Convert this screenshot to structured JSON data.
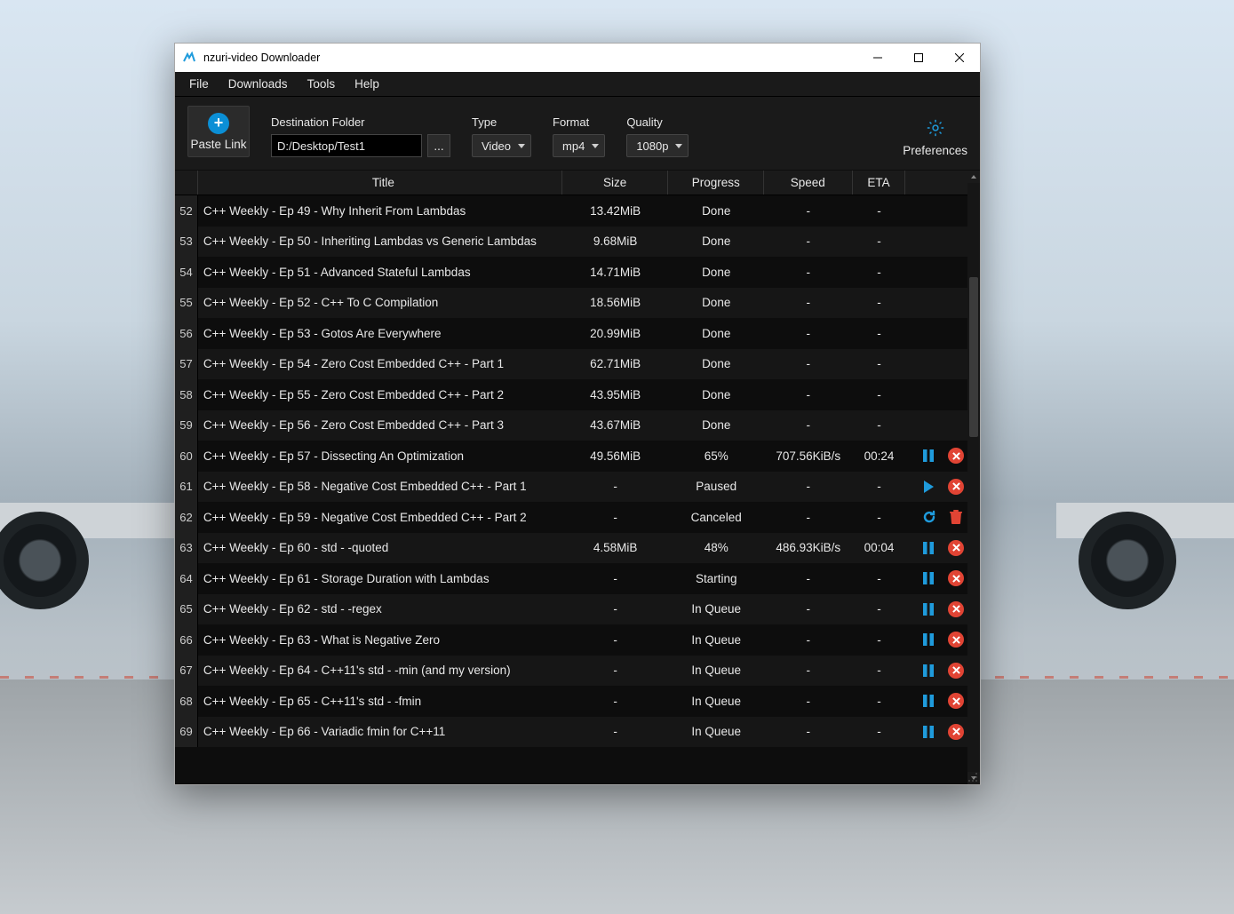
{
  "window": {
    "title": "nzuri-video Downloader"
  },
  "menu": {
    "items": [
      "File",
      "Downloads",
      "Tools",
      "Help"
    ]
  },
  "toolbar": {
    "paste_label": "Paste Link",
    "dest_label": "Destination Folder",
    "dest_value": "D:/Desktop/Test1",
    "browse_label": "...",
    "type_label": "Type",
    "type_value": "Video",
    "format_label": "Format",
    "format_value": "mp4",
    "quality_label": "Quality",
    "quality_value": "1080p",
    "preferences_label": "Preferences"
  },
  "columns": {
    "title": "Title",
    "size": "Size",
    "progress": "Progress",
    "speed": "Speed",
    "eta": "ETA"
  },
  "rows": [
    {
      "n": "52",
      "title": "C++ Weekly - Ep 49 - Why Inherit From Lambdas",
      "size": "13.42MiB",
      "progress": "Done",
      "speed": "-",
      "eta": "-",
      "actions": []
    },
    {
      "n": "53",
      "title": "C++ Weekly - Ep 50 - Inheriting Lambdas vs Generic Lambdas",
      "size": "9.68MiB",
      "progress": "Done",
      "speed": "-",
      "eta": "-",
      "actions": []
    },
    {
      "n": "54",
      "title": "C++ Weekly - Ep 51 - Advanced Stateful Lambdas",
      "size": "14.71MiB",
      "progress": "Done",
      "speed": "-",
      "eta": "-",
      "actions": []
    },
    {
      "n": "55",
      "title": "C++ Weekly - Ep 52 - C++ To C Compilation",
      "size": "18.56MiB",
      "progress": "Done",
      "speed": "-",
      "eta": "-",
      "actions": []
    },
    {
      "n": "56",
      "title": "C++ Weekly - Ep 53 - Gotos Are Everywhere",
      "size": "20.99MiB",
      "progress": "Done",
      "speed": "-",
      "eta": "-",
      "actions": []
    },
    {
      "n": "57",
      "title": "C++ Weekly - Ep 54 - Zero Cost Embedded C++ - Part 1",
      "size": "62.71MiB",
      "progress": "Done",
      "speed": "-",
      "eta": "-",
      "actions": []
    },
    {
      "n": "58",
      "title": "C++ Weekly - Ep 55 - Zero Cost Embedded C++ - Part 2",
      "size": "43.95MiB",
      "progress": "Done",
      "speed": "-",
      "eta": "-",
      "actions": []
    },
    {
      "n": "59",
      "title": "C++ Weekly - Ep 56 - Zero Cost Embedded C++ - Part 3",
      "size": "43.67MiB",
      "progress": "Done",
      "speed": "-",
      "eta": "-",
      "actions": []
    },
    {
      "n": "60",
      "title": "C++ Weekly - Ep 57 - Dissecting An Optimization",
      "size": "49.56MiB",
      "progress": "65%",
      "speed": "707.56KiB/s",
      "eta": "00:24",
      "actions": [
        "pause",
        "cancel"
      ]
    },
    {
      "n": "61",
      "title": "C++ Weekly - Ep 58 - Negative Cost Embedded C++ - Part 1",
      "size": "-",
      "progress": "Paused",
      "speed": "-",
      "eta": "-",
      "actions": [
        "play",
        "cancel"
      ]
    },
    {
      "n": "62",
      "title": "C++ Weekly - Ep 59 - Negative Cost Embedded C++ - Part 2",
      "size": "-",
      "progress": "Canceled",
      "speed": "-",
      "eta": "-",
      "actions": [
        "retry",
        "trash"
      ]
    },
    {
      "n": "63",
      "title": "C++ Weekly - Ep 60 - std - -quoted",
      "size": "4.58MiB",
      "progress": "48%",
      "speed": "486.93KiB/s",
      "eta": "00:04",
      "actions": [
        "pause",
        "cancel"
      ]
    },
    {
      "n": "64",
      "title": "C++ Weekly - Ep 61 - Storage Duration with Lambdas",
      "size": "-",
      "progress": "Starting",
      "speed": "-",
      "eta": "-",
      "actions": [
        "pause",
        "cancel"
      ]
    },
    {
      "n": "65",
      "title": "C++ Weekly - Ep 62 - std - -regex",
      "size": "-",
      "progress": "In Queue",
      "speed": "-",
      "eta": "-",
      "actions": [
        "pause",
        "cancel"
      ]
    },
    {
      "n": "66",
      "title": "C++ Weekly - Ep 63 - What is Negative Zero",
      "size": "-",
      "progress": "In Queue",
      "speed": "-",
      "eta": "-",
      "actions": [
        "pause",
        "cancel"
      ]
    },
    {
      "n": "67",
      "title": "C++ Weekly - Ep 64 - C++11's std - -min (and my version)",
      "size": "-",
      "progress": "In Queue",
      "speed": "-",
      "eta": "-",
      "actions": [
        "pause",
        "cancel"
      ]
    },
    {
      "n": "68",
      "title": "C++ Weekly - Ep 65 - C++11's std - -fmin",
      "size": "-",
      "progress": "In Queue",
      "speed": "-",
      "eta": "-",
      "actions": [
        "pause",
        "cancel"
      ]
    },
    {
      "n": "69",
      "title": "C++ Weekly - Ep 66 - Variadic fmin for C++11",
      "size": "-",
      "progress": "In Queue",
      "speed": "-",
      "eta": "-",
      "actions": [
        "pause",
        "cancel"
      ]
    }
  ]
}
